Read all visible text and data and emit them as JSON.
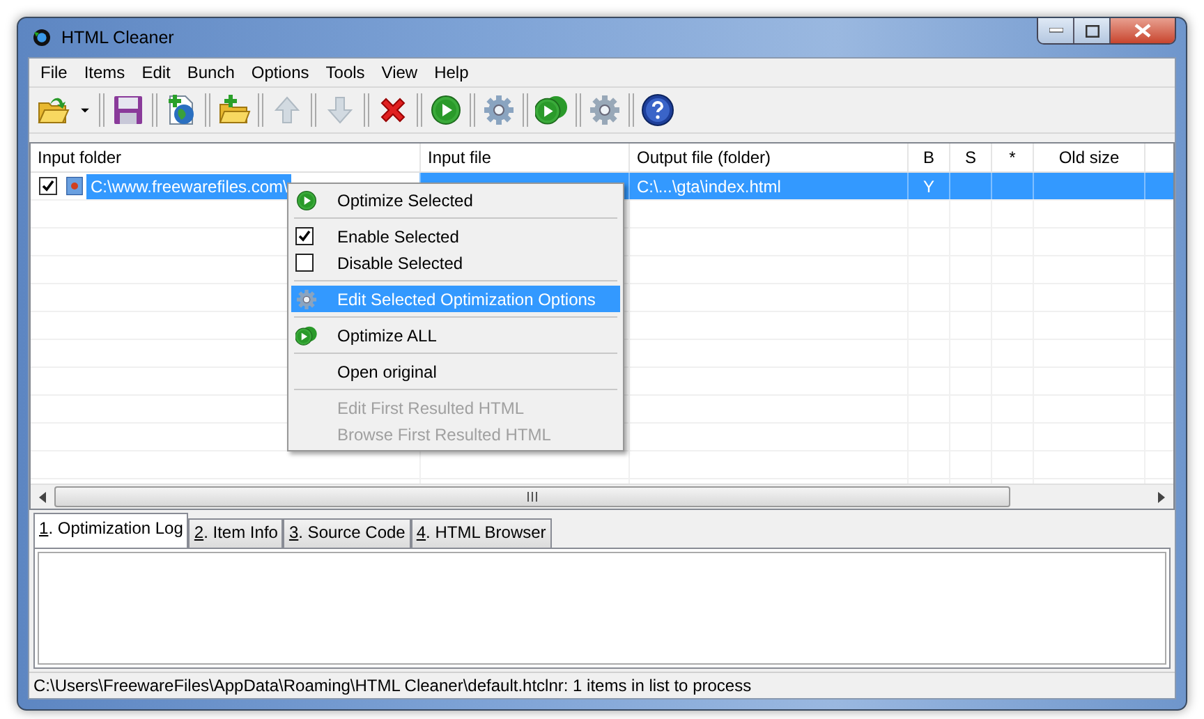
{
  "window": {
    "title": "HTML Cleaner"
  },
  "menu_bar": [
    "File",
    "Items",
    "Edit",
    "Bunch",
    "Options",
    "Tools",
    "View",
    "Help"
  ],
  "toolbar": [
    {
      "kind": "open",
      "disabled": false
    },
    {
      "kind": "dropdown",
      "disabled": false
    },
    {
      "kind": "save",
      "disabled": false
    },
    {
      "kind": "add-file",
      "disabled": false
    },
    {
      "kind": "add-folder",
      "disabled": false
    },
    {
      "kind": "move-up",
      "disabled": true
    },
    {
      "kind": "move-down",
      "disabled": true
    },
    {
      "kind": "delete",
      "disabled": false
    },
    {
      "kind": "optimize",
      "disabled": false
    },
    {
      "kind": "settings",
      "disabled": false
    },
    {
      "kind": "optimize-all",
      "disabled": false
    },
    {
      "kind": "options",
      "disabled": false
    },
    {
      "kind": "help",
      "disabled": false
    }
  ],
  "table": {
    "columns": [
      "Input folder",
      "Input file",
      "Output file (folder)",
      "B",
      "S",
      "*",
      "Old size"
    ],
    "rows": [
      {
        "checked": true,
        "selected": true,
        "input_folder": "C:\\www.freewarefiles.com\\",
        "output_file": "C:\\...\\gta\\index.html",
        "b": "Y"
      }
    ]
  },
  "context_menu": [
    {
      "kind": "play",
      "label": "Optimize Selected",
      "selected": false,
      "disabled": false
    },
    {
      "kind": "separator"
    },
    {
      "kind": "checkbox",
      "label": "Enable Selected",
      "checked": true,
      "selected": false,
      "disabled": false
    },
    {
      "kind": "checkbox",
      "label": "Disable Selected",
      "checked": false,
      "selected": false,
      "disabled": false
    },
    {
      "kind": "separator"
    },
    {
      "kind": "gear",
      "label": "Edit Selected Optimization Options",
      "selected": true,
      "disabled": false
    },
    {
      "kind": "separator"
    },
    {
      "kind": "play-all",
      "label": "Optimize ALL",
      "selected": false,
      "disabled": false
    },
    {
      "kind": "separator"
    },
    {
      "kind": "plain",
      "label": "Open original",
      "selected": false,
      "disabled": false
    },
    {
      "kind": "separator"
    },
    {
      "kind": "plain",
      "label": "Edit First Resulted HTML",
      "selected": false,
      "disabled": true
    },
    {
      "kind": "plain",
      "label": "Browse First Resulted HTML",
      "selected": false,
      "disabled": true
    }
  ],
  "tabs": [
    {
      "label": "1. Optimization Log",
      "selected": true
    },
    {
      "label": "2. Item Info",
      "selected": false
    },
    {
      "label": "3. Source Code",
      "selected": false
    },
    {
      "label": "4. HTML Browser",
      "selected": false
    }
  ],
  "status_bar": "C:\\Users\\FreewareFiles\\AppData\\Roaming\\HTML Cleaner\\default.htclnr: 1 items in list to process"
}
